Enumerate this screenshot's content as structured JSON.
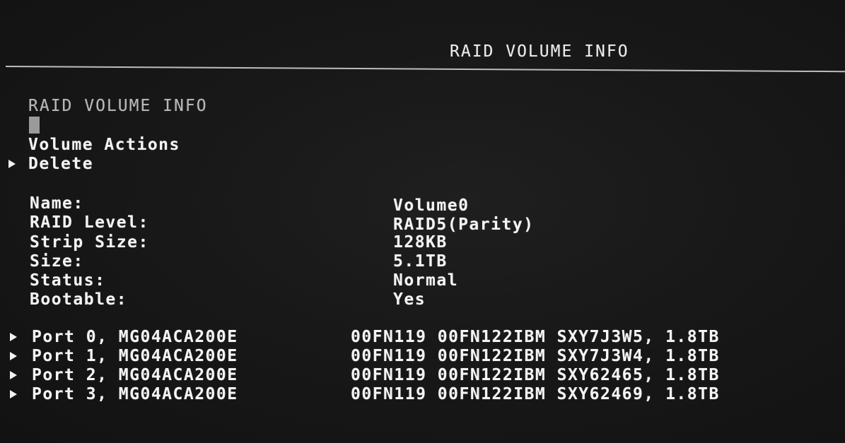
{
  "header": {
    "title": "RAID VOLUME INFO"
  },
  "section": {
    "title": "RAID VOLUME INFO"
  },
  "actions": {
    "heading": "Volume Actions",
    "delete_label": "Delete"
  },
  "properties": [
    {
      "label": "Name:",
      "value": "Volume0"
    },
    {
      "label": "RAID Level:",
      "value": "RAID5(Parity)"
    },
    {
      "label": "Strip Size:",
      "value": "128KB"
    },
    {
      "label": "Size:",
      "value": "5.1TB"
    },
    {
      "label": "Status:",
      "value": "Normal"
    },
    {
      "label": "Bootable:",
      "value": "Yes"
    }
  ],
  "ports": [
    {
      "label": "Port 0, MG04ACA200E",
      "detail": "00FN119 00FN122IBM SXY7J3W5, 1.8TB"
    },
    {
      "label": "Port 1, MG04ACA200E",
      "detail": "00FN119 00FN122IBM SXY7J3W4, 1.8TB"
    },
    {
      "label": "Port 2, MG04ACA200E",
      "detail": "00FN119 00FN122IBM SXY62465, 1.8TB"
    },
    {
      "label": "Port 3, MG04ACA200E",
      "detail": "00FN119 00FN122IBM SXY62469, 1.8TB"
    }
  ],
  "colors": {
    "background": "#181818",
    "text": "#f4f4f4",
    "dim_text": "#b8b8b8"
  },
  "icons": {
    "selector": "triangle-right-icon",
    "cursor": "block-cursor-icon"
  }
}
